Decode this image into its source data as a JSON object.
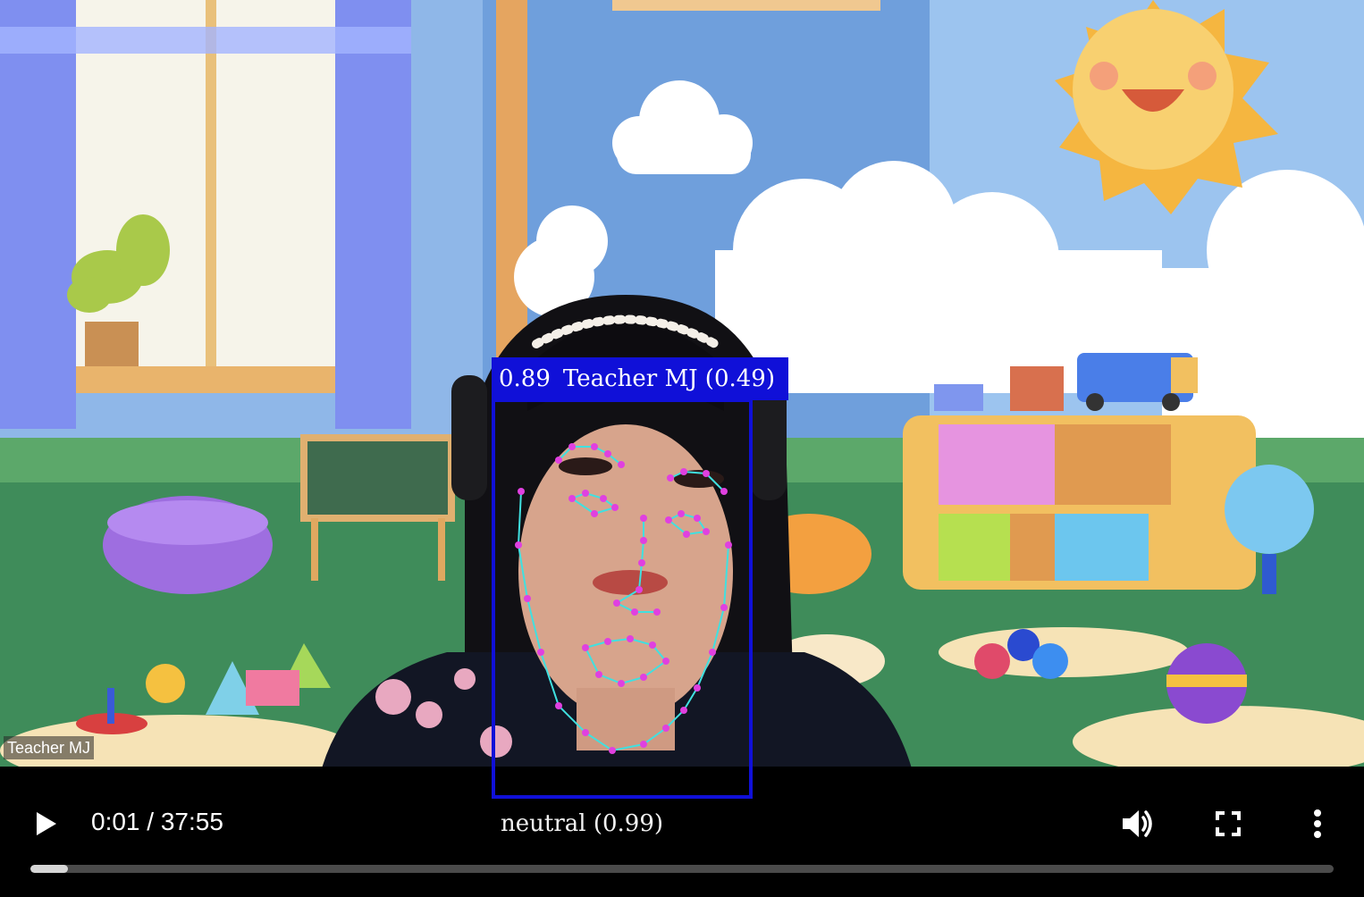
{
  "video": {
    "participant_name": "Teacher MJ",
    "current_time": "0:01",
    "time_separator": "/",
    "duration": "37:55",
    "progress_fraction": 0.029
  },
  "detection": {
    "confidence": "0.89",
    "identity": "Teacher MJ (0.49)",
    "emotion": "neutral (0.99)",
    "box_color": "#1010d8",
    "landmark_color": "#e040e0",
    "contour_color": "#40e0e0"
  },
  "controls": {
    "play_icon": "play-icon",
    "volume_icon": "volume-icon",
    "fullscreen_icon": "fullscreen-icon",
    "more_icon": "more-vertical-icon"
  }
}
